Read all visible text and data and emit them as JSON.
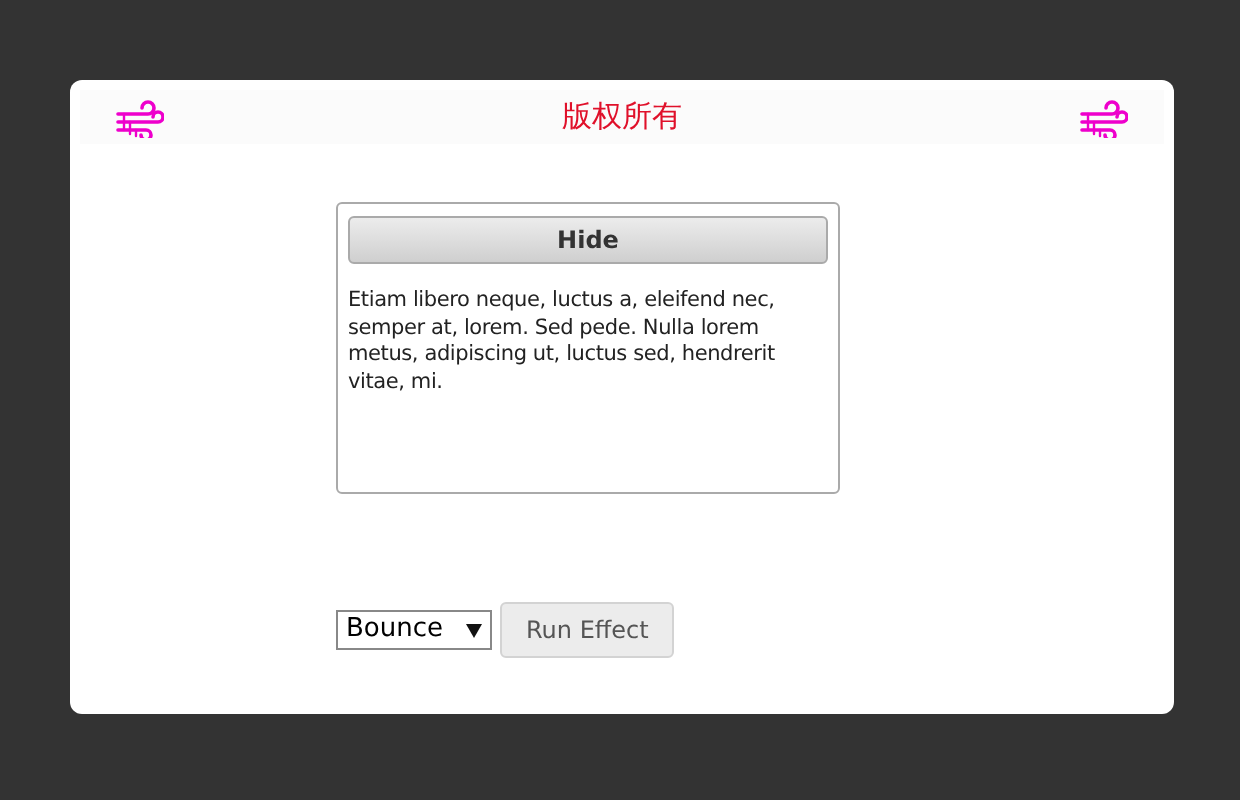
{
  "header": {
    "title": "版权所有"
  },
  "panel": {
    "button": "Hide",
    "text": "Etiam libero neque, luctus a, eleifend nec, semper at, lorem. Sed pede. Nulla lorem metus, adipiscing ut, luctus sed, hendrerit vitae, mi."
  },
  "controls": {
    "effect_select": {
      "value": "Bounce"
    },
    "run_button": "Run Effect"
  }
}
